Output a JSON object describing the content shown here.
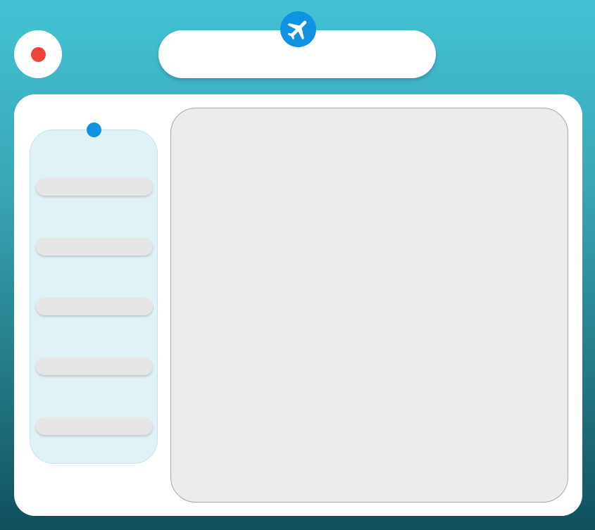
{
  "header": {
    "search_placeholder": "",
    "search_value": ""
  },
  "sidebar": {
    "items": [
      {
        "label": ""
      },
      {
        "label": ""
      },
      {
        "label": ""
      },
      {
        "label": ""
      },
      {
        "label": ""
      }
    ]
  },
  "icons": {
    "record": "record-icon",
    "plane": "airplane-icon",
    "sidebar_dot": "dot-icon"
  },
  "colors": {
    "record": "#ef4438",
    "accent": "#0e93e3",
    "sidebar_bg": "#e1f2f7",
    "item_bg": "#e6e6e6",
    "content_bg": "#ececec"
  }
}
